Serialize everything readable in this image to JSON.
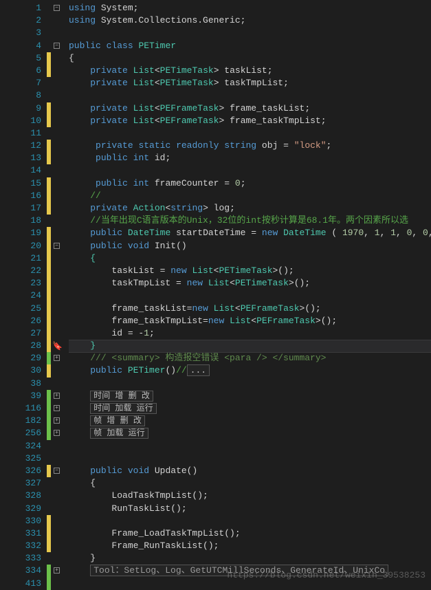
{
  "lines": [
    {
      "n": 1,
      "fold": "minus",
      "bar": null,
      "tokens": [
        {
          "t": "kw",
          "s": "using"
        },
        {
          "t": "id",
          "s": " System;"
        }
      ]
    },
    {
      "n": 2,
      "tokens": [
        {
          "t": "kw",
          "s": "using"
        },
        {
          "t": "id",
          "s": " System.Collections.Generic;"
        }
      ]
    },
    {
      "n": 3,
      "tokens": []
    },
    {
      "n": 4,
      "fold": "minus",
      "tokens": [
        {
          "t": "kw",
          "s": "public"
        },
        {
          "t": "id",
          "s": " "
        },
        {
          "t": "kw",
          "s": "class"
        },
        {
          "t": "id",
          "s": " "
        },
        {
          "t": "type",
          "s": "PETimer"
        }
      ]
    },
    {
      "n": 5,
      "bar": "yellow",
      "tokens": [
        {
          "t": "id",
          "s": "{"
        }
      ]
    },
    {
      "n": 6,
      "bar": "yellow",
      "tokens": [
        {
          "t": "id",
          "s": "    "
        },
        {
          "t": "kw",
          "s": "private"
        },
        {
          "t": "id",
          "s": " "
        },
        {
          "t": "type",
          "s": "List"
        },
        {
          "t": "id",
          "s": "<"
        },
        {
          "t": "type",
          "s": "PETimeTask"
        },
        {
          "t": "id",
          "s": "> taskList;"
        }
      ]
    },
    {
      "n": 7,
      "tokens": [
        {
          "t": "id",
          "s": "    "
        },
        {
          "t": "kw",
          "s": "private"
        },
        {
          "t": "id",
          "s": " "
        },
        {
          "t": "type",
          "s": "List"
        },
        {
          "t": "id",
          "s": "<"
        },
        {
          "t": "type",
          "s": "PETimeTask"
        },
        {
          "t": "id",
          "s": "> taskTmpList;"
        }
      ]
    },
    {
      "n": 8,
      "tokens": []
    },
    {
      "n": 9,
      "bar": "yellow",
      "tokens": [
        {
          "t": "id",
          "s": "    "
        },
        {
          "t": "kw",
          "s": "private"
        },
        {
          "t": "id",
          "s": " "
        },
        {
          "t": "type",
          "s": "List"
        },
        {
          "t": "id",
          "s": "<"
        },
        {
          "t": "type",
          "s": "PEFrameTask"
        },
        {
          "t": "id",
          "s": "> frame_taskList;"
        }
      ]
    },
    {
      "n": 10,
      "bar": "yellow",
      "tokens": [
        {
          "t": "id",
          "s": "    "
        },
        {
          "t": "kw",
          "s": "private"
        },
        {
          "t": "id",
          "s": " "
        },
        {
          "t": "type",
          "s": "List"
        },
        {
          "t": "id",
          "s": "<"
        },
        {
          "t": "type",
          "s": "PEFrameTask"
        },
        {
          "t": "id",
          "s": "> frame_taskTmpList;"
        }
      ]
    },
    {
      "n": 11,
      "tokens": []
    },
    {
      "n": 12,
      "bar": "yellow",
      "tokens": [
        {
          "t": "id",
          "s": "     "
        },
        {
          "t": "kw",
          "s": "private"
        },
        {
          "t": "id",
          "s": " "
        },
        {
          "t": "kw",
          "s": "static"
        },
        {
          "t": "id",
          "s": " "
        },
        {
          "t": "kw",
          "s": "readonly"
        },
        {
          "t": "id",
          "s": " "
        },
        {
          "t": "kw",
          "s": "string"
        },
        {
          "t": "id",
          "s": " obj = "
        },
        {
          "t": "str",
          "s": "\"lock\""
        },
        {
          "t": "id",
          "s": ";"
        }
      ]
    },
    {
      "n": 13,
      "bar": "yellow",
      "tokens": [
        {
          "t": "id",
          "s": "     "
        },
        {
          "t": "kw",
          "s": "public"
        },
        {
          "t": "id",
          "s": " "
        },
        {
          "t": "kw",
          "s": "int"
        },
        {
          "t": "id",
          "s": " id;"
        }
      ]
    },
    {
      "n": 14,
      "tokens": []
    },
    {
      "n": 15,
      "bar": "yellow",
      "tokens": [
        {
          "t": "id",
          "s": "     "
        },
        {
          "t": "kw",
          "s": "public"
        },
        {
          "t": "id",
          "s": " "
        },
        {
          "t": "kw",
          "s": "int"
        },
        {
          "t": "id",
          "s": " frameCounter = "
        },
        {
          "t": "num",
          "s": "0"
        },
        {
          "t": "id",
          "s": ";"
        }
      ]
    },
    {
      "n": 16,
      "bar": "yellow",
      "tokens": [
        {
          "t": "id",
          "s": "    "
        },
        {
          "t": "cmt",
          "s": "//"
        }
      ]
    },
    {
      "n": 17,
      "bar": "yellow",
      "tokens": [
        {
          "t": "id",
          "s": "    "
        },
        {
          "t": "kw",
          "s": "private"
        },
        {
          "t": "id",
          "s": " "
        },
        {
          "t": "type",
          "s": "Action"
        },
        {
          "t": "id",
          "s": "<"
        },
        {
          "t": "kw",
          "s": "string"
        },
        {
          "t": "id",
          "s": "> log;"
        }
      ]
    },
    {
      "n": 18,
      "tokens": [
        {
          "t": "id",
          "s": "    "
        },
        {
          "t": "cmt",
          "s": "//当年出现C语言版本的Unix，32位的int按秒计算是68.1年。两个因素所以选"
        }
      ]
    },
    {
      "n": 19,
      "bar": "yellow",
      "tokens": [
        {
          "t": "id",
          "s": "    "
        },
        {
          "t": "kw",
          "s": "public"
        },
        {
          "t": "id",
          "s": " "
        },
        {
          "t": "type",
          "s": "DateTime"
        },
        {
          "t": "id",
          "s": " startDateTime = "
        },
        {
          "t": "kw",
          "s": "new"
        },
        {
          "t": "id",
          "s": " "
        },
        {
          "t": "type",
          "s": "DateTime"
        },
        {
          "t": "id",
          "s": " ( "
        },
        {
          "t": "num",
          "s": "1970"
        },
        {
          "t": "id",
          "s": ", "
        },
        {
          "t": "num",
          "s": "1"
        },
        {
          "t": "id",
          "s": ", "
        },
        {
          "t": "num",
          "s": "1"
        },
        {
          "t": "id",
          "s": ", "
        },
        {
          "t": "num",
          "s": "0"
        },
        {
          "t": "id",
          "s": ", "
        },
        {
          "t": "num",
          "s": "0"
        },
        {
          "t": "id",
          "s": ", "
        },
        {
          "t": "num",
          "s": "0"
        },
        {
          "t": "id",
          "s": ","
        }
      ]
    },
    {
      "n": 20,
      "fold": "minus",
      "bar": "yellow",
      "tokens": [
        {
          "t": "id",
          "s": "    "
        },
        {
          "t": "kw",
          "s": "public"
        },
        {
          "t": "id",
          "s": " "
        },
        {
          "t": "kw",
          "s": "void"
        },
        {
          "t": "id",
          "s": " Init()"
        }
      ]
    },
    {
      "n": 21,
      "bar": "yellow",
      "tokens": [
        {
          "t": "id",
          "s": "    "
        },
        {
          "t": "type",
          "s": "{"
        }
      ]
    },
    {
      "n": 22,
      "bar": "yellow",
      "tokens": [
        {
          "t": "id",
          "s": "        taskList = "
        },
        {
          "t": "kw",
          "s": "new"
        },
        {
          "t": "id",
          "s": " "
        },
        {
          "t": "type",
          "s": "List"
        },
        {
          "t": "id",
          "s": "<"
        },
        {
          "t": "type",
          "s": "PETimeTask"
        },
        {
          "t": "id",
          "s": ">();"
        }
      ]
    },
    {
      "n": 23,
      "bar": "yellow",
      "tokens": [
        {
          "t": "id",
          "s": "        taskTmpList = "
        },
        {
          "t": "kw",
          "s": "new"
        },
        {
          "t": "id",
          "s": " "
        },
        {
          "t": "type",
          "s": "List"
        },
        {
          "t": "id",
          "s": "<"
        },
        {
          "t": "type",
          "s": "PETimeTask"
        },
        {
          "t": "id",
          "s": ">();"
        }
      ]
    },
    {
      "n": 24,
      "bar": "yellow",
      "tokens": []
    },
    {
      "n": 25,
      "bar": "yellow",
      "tokens": [
        {
          "t": "id",
          "s": "        frame_taskList="
        },
        {
          "t": "kw",
          "s": "new"
        },
        {
          "t": "id",
          "s": " "
        },
        {
          "t": "type",
          "s": "List"
        },
        {
          "t": "id",
          "s": "<"
        },
        {
          "t": "type",
          "s": "PEFrameTask"
        },
        {
          "t": "id",
          "s": ">();"
        }
      ]
    },
    {
      "n": 26,
      "bar": "yellow",
      "tokens": [
        {
          "t": "id",
          "s": "        frame_taskTmpList="
        },
        {
          "t": "kw",
          "s": "new"
        },
        {
          "t": "id",
          "s": " "
        },
        {
          "t": "type",
          "s": "List"
        },
        {
          "t": "id",
          "s": "<"
        },
        {
          "t": "type",
          "s": "PEFrameTask"
        },
        {
          "t": "id",
          "s": ">();"
        }
      ]
    },
    {
      "n": 27,
      "bar": "yellow",
      "tokens": [
        {
          "t": "id",
          "s": "        id = -"
        },
        {
          "t": "num",
          "s": "1"
        },
        {
          "t": "id",
          "s": ";"
        }
      ]
    },
    {
      "n": 28,
      "bar": "yellow",
      "bookmark": true,
      "current": true,
      "tokens": [
        {
          "t": "id",
          "s": "    "
        },
        {
          "t": "type",
          "s": "}"
        }
      ]
    },
    {
      "n": 29,
      "fold": "plus",
      "bar": "green",
      "tokens": [
        {
          "t": "id",
          "s": "    "
        },
        {
          "t": "xml",
          "s": "/// <summary> 构造报空错误 <para /> </summary>"
        }
      ]
    },
    {
      "n": 30,
      "bar": "yellow",
      "tokens": [
        {
          "t": "id",
          "s": "    "
        },
        {
          "t": "kw",
          "s": "public"
        },
        {
          "t": "id",
          "s": " "
        },
        {
          "t": "type",
          "s": "PETimer"
        },
        {
          "t": "id",
          "s": "()"
        },
        {
          "t": "cmt",
          "s": "//"
        },
        {
          "t": "box",
          "s": "..."
        }
      ]
    },
    {
      "n": 38,
      "tokens": []
    },
    {
      "n": 39,
      "fold": "plus",
      "bar": "green",
      "tokens": [
        {
          "t": "id",
          "s": "    "
        },
        {
          "t": "region",
          "s": "时间 增 删 改"
        }
      ]
    },
    {
      "n": 116,
      "fold": "plus",
      "bar": "green",
      "tokens": [
        {
          "t": "id",
          "s": "    "
        },
        {
          "t": "region",
          "s": "时间 加载 运行"
        }
      ]
    },
    {
      "n": 182,
      "fold": "plus",
      "bar": "green",
      "tokens": [
        {
          "t": "id",
          "s": "    "
        },
        {
          "t": "region",
          "s": "帧 增 删 改"
        }
      ]
    },
    {
      "n": 256,
      "fold": "plus",
      "bar": "green",
      "tokens": [
        {
          "t": "id",
          "s": "    "
        },
        {
          "t": "region",
          "s": "帧 加载 运行"
        }
      ]
    },
    {
      "n": 324,
      "tokens": []
    },
    {
      "n": 325,
      "tokens": []
    },
    {
      "n": 326,
      "fold": "minus",
      "bar": "yellow",
      "tokens": [
        {
          "t": "id",
          "s": "    "
        },
        {
          "t": "kw",
          "s": "public"
        },
        {
          "t": "id",
          "s": " "
        },
        {
          "t": "kw",
          "s": "void"
        },
        {
          "t": "id",
          "s": " Update()"
        }
      ]
    },
    {
      "n": 327,
      "tokens": [
        {
          "t": "id",
          "s": "    {"
        }
      ]
    },
    {
      "n": 328,
      "tokens": [
        {
          "t": "id",
          "s": "        LoadTaskTmpList();"
        }
      ]
    },
    {
      "n": 329,
      "tokens": [
        {
          "t": "id",
          "s": "        RunTaskList();"
        }
      ]
    },
    {
      "n": 330,
      "bar": "yellow",
      "tokens": []
    },
    {
      "n": 331,
      "bar": "yellow",
      "tokens": [
        {
          "t": "id",
          "s": "        Frame_LoadTaskTmpList();"
        }
      ]
    },
    {
      "n": 332,
      "bar": "yellow",
      "tokens": [
        {
          "t": "id",
          "s": "        Frame_RunTaskList();"
        }
      ]
    },
    {
      "n": 333,
      "tokens": [
        {
          "t": "id",
          "s": "    }"
        }
      ]
    },
    {
      "n": 334,
      "fold": "plus",
      "bar": "green",
      "tokens": [
        {
          "t": "id",
          "s": "    "
        },
        {
          "t": "tool",
          "s": "Tool：SetLog、Log、GetUTCMillSeconds、GenerateId、UnixCo"
        }
      ]
    },
    {
      "n": 413,
      "bar": "green",
      "tokens": []
    }
  ],
  "watermark": "https://blog.csdn.net/weixin_39538253"
}
